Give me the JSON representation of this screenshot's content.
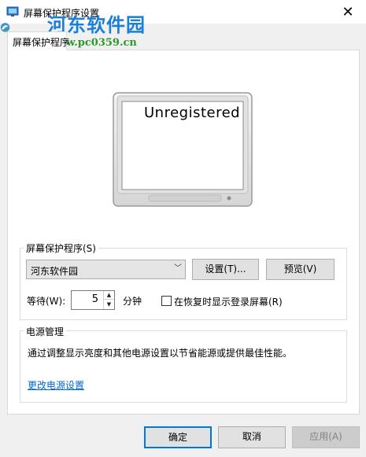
{
  "window": {
    "title": "屏幕保护程序设置",
    "close_glyph": "✕"
  },
  "watermark": {
    "site_name": "河东软件园",
    "url": "www.pc0359.cn"
  },
  "tab": {
    "label": "屏幕保护程序"
  },
  "preview": {
    "text": "Unregistered"
  },
  "screensaver": {
    "group_label": "屏幕保护程序(S)",
    "selected": "河东软件园",
    "settings_label": "设置(T)...",
    "preview_label": "预览(V)",
    "wait_label": "等待(W):",
    "wait_value": "5",
    "minutes_label": "分钟",
    "resume_label": "在恢复时显示登录屏幕(R)",
    "resume_checked": false
  },
  "power": {
    "group_label": "电源管理",
    "description": "通过调整显示亮度和其他电源设置以节省能源或提供最佳性能。",
    "link_label": "更改电源设置"
  },
  "footer": {
    "ok_label": "确定",
    "cancel_label": "取消",
    "apply_label": "应用(A)"
  },
  "colors": {
    "accent": "#0078d7",
    "link": "#0066cc",
    "watermark_blue": "#1a7fd8",
    "watermark_green": "#2a9a2a"
  }
}
